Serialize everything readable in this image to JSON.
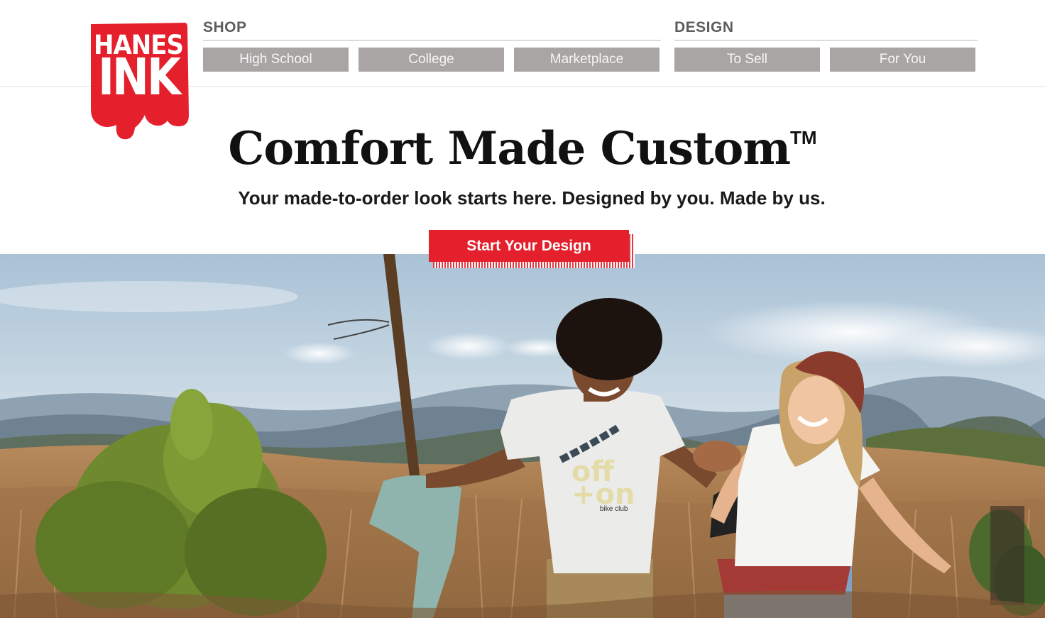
{
  "brand": {
    "logo_line1": "HANES",
    "logo_line2": "INK",
    "color": "#e3202c"
  },
  "nav": {
    "shop": {
      "heading": "SHOP",
      "items": [
        {
          "label": "High School"
        },
        {
          "label": "College"
        },
        {
          "label": "Marketplace"
        }
      ]
    },
    "design": {
      "heading": "DESIGN",
      "items": [
        {
          "label": "To Sell"
        },
        {
          "label": "For You"
        }
      ]
    },
    "button_color": "#aaa5a5"
  },
  "hero": {
    "headline": "Comfort Made Custom",
    "trademark": "TM",
    "subheadline": "Your made-to-order look starts here. Designed by you. Made by us.",
    "cta_label": "Start Your Design",
    "cta_color": "#e3202c"
  },
  "photo": {
    "shirt_text_line1": "off",
    "shirt_text_line2": "+on",
    "shirt_text_line3": "bike club"
  }
}
